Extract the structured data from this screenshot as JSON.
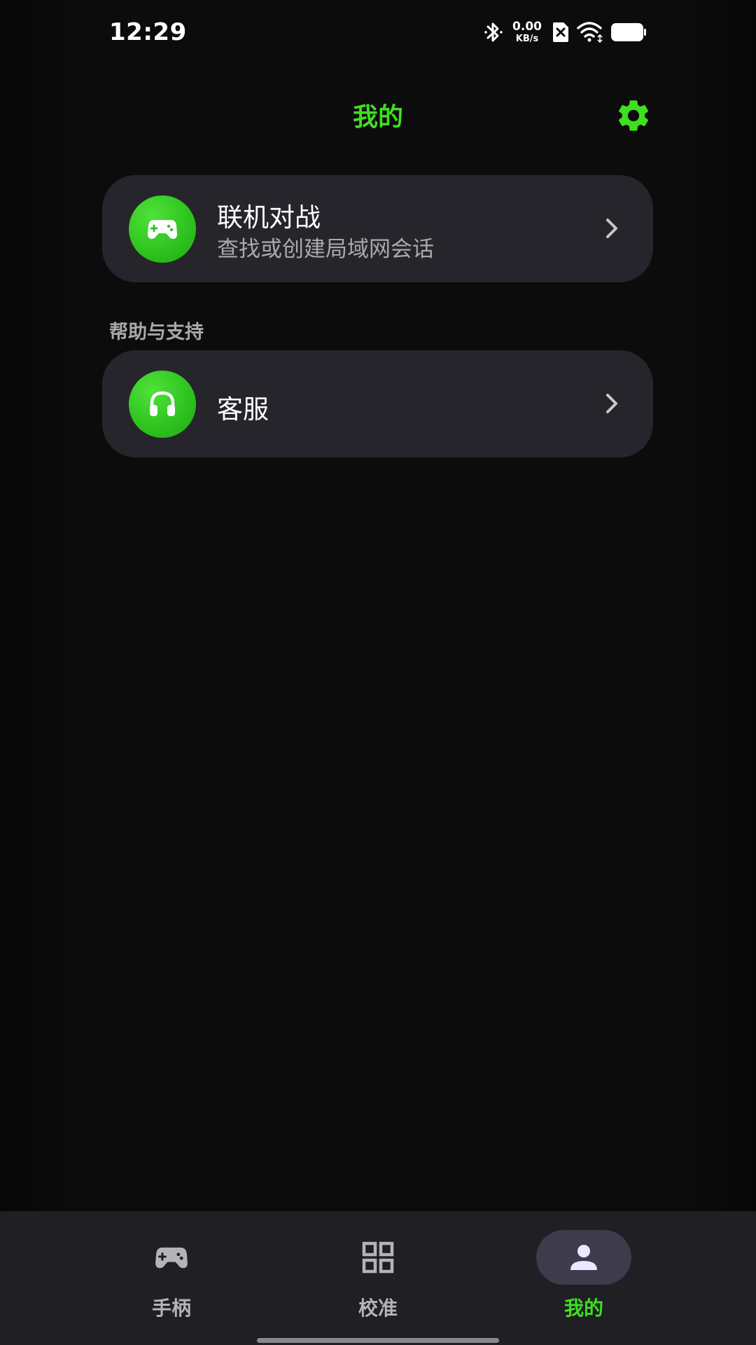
{
  "status_bar": {
    "time": "12:29",
    "net_speed_value": "0.00",
    "net_speed_unit": "KB/s",
    "icons": [
      "bluetooth-icon",
      "no-sim-icon",
      "wifi-icon",
      "battery-icon"
    ]
  },
  "header": {
    "title": "我的",
    "settings_icon": "gear-icon"
  },
  "cards": {
    "multiplayer": {
      "title": "联机对战",
      "subtitle": "查找或创建局域网会话",
      "icon": "gamepad-icon"
    },
    "customer_service": {
      "title": "客服",
      "icon": "headphones-icon"
    }
  },
  "sections": {
    "help_support": "帮助与支持"
  },
  "bottom_nav": {
    "items": [
      {
        "label": "手柄",
        "icon": "gamepad-icon",
        "active": false
      },
      {
        "label": "校准",
        "icon": "grid-icon",
        "active": false
      },
      {
        "label": "我的",
        "icon": "person-icon",
        "active": true
      }
    ]
  },
  "colors": {
    "accent_green": "#3ee01f",
    "card_bg": "#26252b",
    "nav_bg": "#1f1f24",
    "active_pill": "#3e3c4c"
  }
}
